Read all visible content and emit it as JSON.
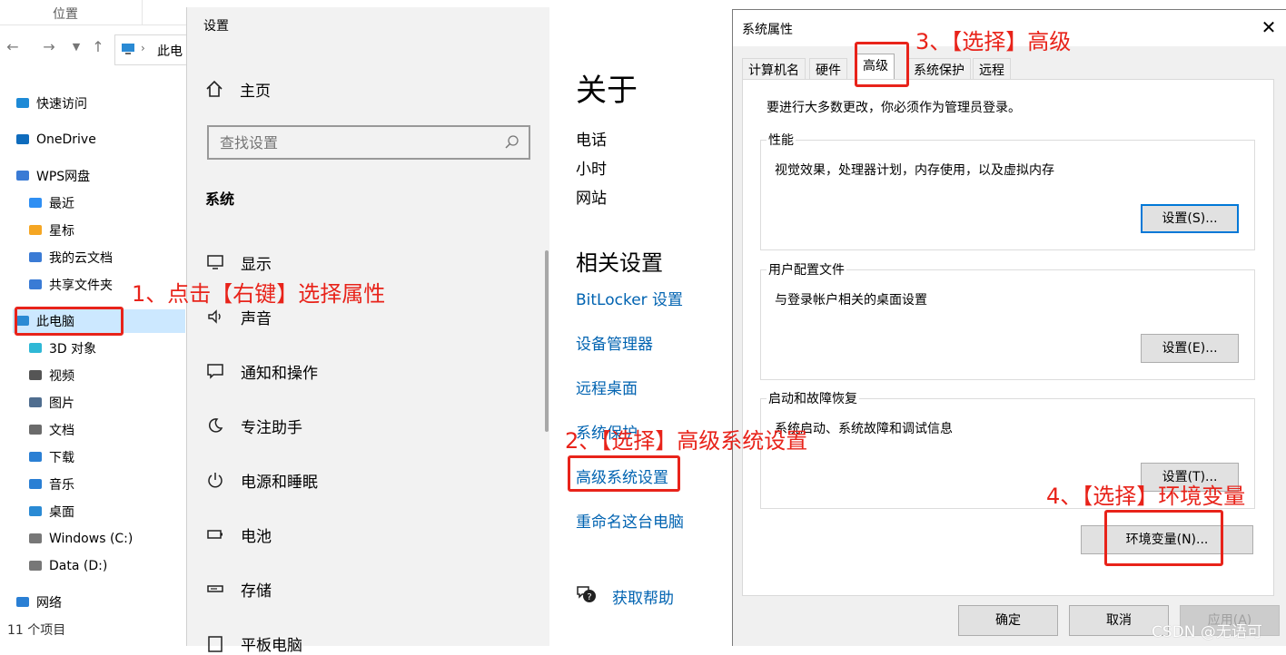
{
  "explorer": {
    "header_col": "位置",
    "address": "此电",
    "tree": [
      {
        "label": "快速访问",
        "icon": "star-icon",
        "color": "#1e8ad6"
      },
      {
        "label": "OneDrive",
        "icon": "cloud-icon",
        "color": "#0f6cbd"
      },
      {
        "label": "WPS网盘",
        "icon": "wps-cloud-icon",
        "color": "#3a7bd5"
      },
      {
        "label": "最近",
        "icon": "clock-icon",
        "color": "#2f8ff3"
      },
      {
        "label": "星标",
        "icon": "star-filled-icon",
        "color": "#f5a623"
      },
      {
        "label": "我的云文档",
        "icon": "cloud-doc-icon",
        "color": "#3a7bd5"
      },
      {
        "label": "共享文件夹",
        "icon": "share-folder-icon",
        "color": "#3a7bd5"
      },
      {
        "label": "此电脑",
        "icon": "computer-icon",
        "color": "#2a8ad4"
      },
      {
        "label": "3D 对象",
        "icon": "cube-icon",
        "color": "#2fb8d6"
      },
      {
        "label": "视频",
        "icon": "film-icon",
        "color": "#555555"
      },
      {
        "label": "图片",
        "icon": "picture-icon",
        "color": "#4f6d8f"
      },
      {
        "label": "文档",
        "icon": "document-icon",
        "color": "#6b6b6b"
      },
      {
        "label": "下载",
        "icon": "download-icon",
        "color": "#2a7fd4"
      },
      {
        "label": "音乐",
        "icon": "music-icon",
        "color": "#2a7fd4"
      },
      {
        "label": "桌面",
        "icon": "desktop-icon",
        "color": "#2a8ad4"
      },
      {
        "label": "Windows (C:)",
        "icon": "drive-c-icon",
        "color": "#777777"
      },
      {
        "label": "Data (D:)",
        "icon": "drive-icon",
        "color": "#777777"
      },
      {
        "label": "网络",
        "icon": "network-icon",
        "color": "#2a7fd4"
      }
    ],
    "status": "11 个项目"
  },
  "settings": {
    "window_title": "设置",
    "home": "主页",
    "search_placeholder": "查找设置",
    "section": "系统",
    "nav": [
      {
        "label": "显示",
        "icon": "monitor-icon"
      },
      {
        "label": "声音",
        "icon": "speaker-icon"
      },
      {
        "label": "通知和操作",
        "icon": "notification-icon"
      },
      {
        "label": "专注助手",
        "icon": "moon-icon"
      },
      {
        "label": "电源和睡眠",
        "icon": "power-icon"
      },
      {
        "label": "电池",
        "icon": "battery-icon"
      },
      {
        "label": "存储",
        "icon": "storage-icon"
      },
      {
        "label": "平板电脑",
        "icon": "tablet-icon"
      }
    ]
  },
  "about": {
    "title": "关于",
    "items": [
      "电话",
      "小时",
      "网站"
    ],
    "related_title": "相关设置",
    "links": [
      "BitLocker 设置",
      "设备管理器",
      "远程桌面",
      "系统保护",
      "高级系统设置",
      "重命名这台电脑"
    ],
    "help": "获取帮助"
  },
  "dialog": {
    "title": "系统属性",
    "tabs": [
      "计算机名",
      "硬件",
      "高级",
      "系统保护",
      "远程"
    ],
    "note": "要进行大多数更改，你必须作为管理员登录。",
    "groups": [
      {
        "title": "性能",
        "desc": "视觉效果，处理器计划，内存使用，以及虚拟内存",
        "button": "设置(S)..."
      },
      {
        "title": "用户配置文件",
        "desc": "与登录帐户相关的桌面设置",
        "button": "设置(E)..."
      },
      {
        "title": "启动和故障恢复",
        "desc": "系统启动、系统故障和调试信息",
        "button": "设置(T)..."
      }
    ],
    "env_button": "环境变量(N)...",
    "ok": "确定",
    "cancel": "取消",
    "apply": "应用(A)"
  },
  "annotations": {
    "step1": "1、点击【右键】选择属性",
    "step2": "2、【选择】高级系统设置",
    "step3": "3、【选择】高级",
    "step4": "4、【选择】环境变量",
    "color": "#e8231a"
  },
  "watermark": "CSDN @无语可"
}
